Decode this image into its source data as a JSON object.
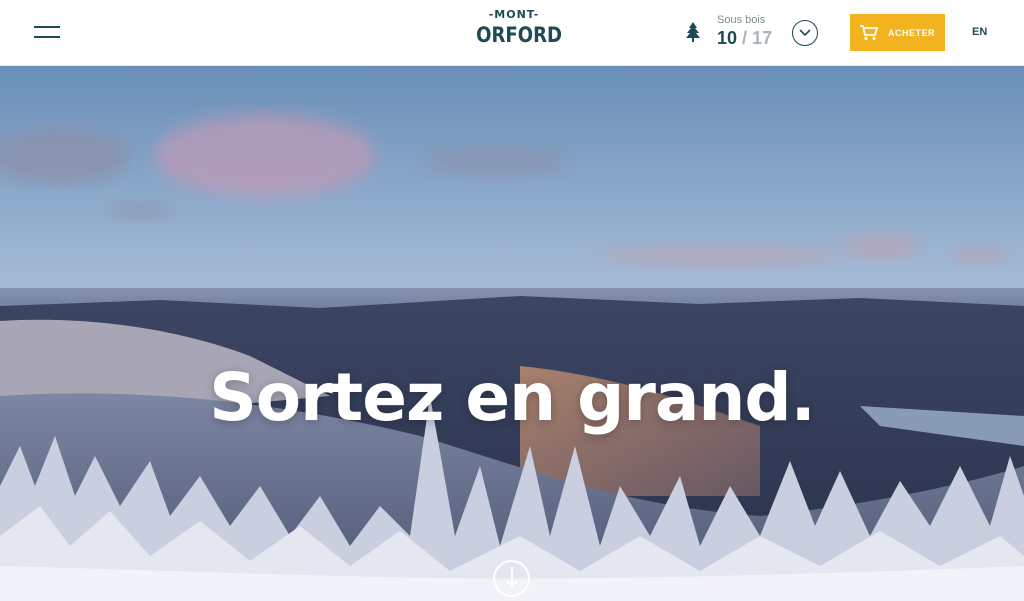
{
  "header": {
    "menu_icon": "hamburger-menu-icon",
    "logo": {
      "top_text": "-MONT-",
      "main_text": "ORFORD"
    },
    "conditions": {
      "icon": "pine-tree-icon",
      "label": "Sous bois",
      "open": "10",
      "separator": "/",
      "total": "17",
      "toggle_icon": "chevron-down-icon"
    },
    "buy_button": {
      "icon": "cart-icon",
      "label": "ACHETER",
      "color": "#f2b31e"
    },
    "language": "EN",
    "brand_color": "#1d4a54"
  },
  "hero": {
    "headline": "Sortez en grand.",
    "scroll_icon": "arrow-down-circle-icon"
  }
}
